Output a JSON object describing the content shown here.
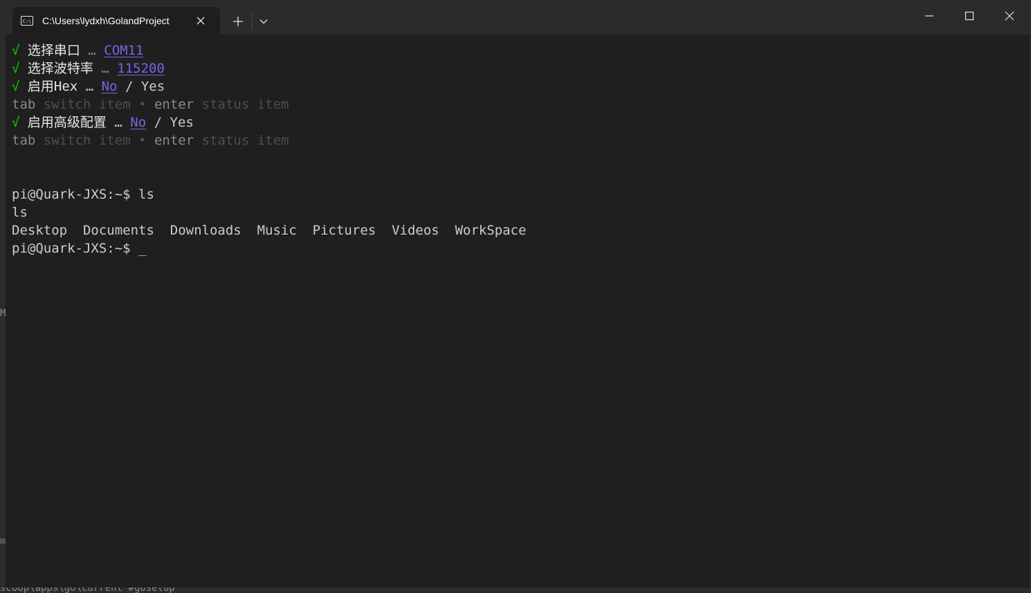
{
  "tab": {
    "icon": "terminal-prompt-icon",
    "title": "C:\\Users\\lydxh\\GolandProject"
  },
  "window_controls": {
    "minimize_icon": "minimize-icon",
    "maximize_icon": "maximize-icon",
    "close_icon": "close-icon"
  },
  "terminal": {
    "prompts": [
      {
        "check": "√",
        "question": "选择串口",
        "sep": "…",
        "answer": "COM11"
      },
      {
        "check": "√",
        "question": "选择波特率",
        "sep": "…",
        "answer": "115200"
      },
      {
        "check": "√",
        "question": "启用Hex",
        "sep": "…",
        "selected": "No",
        "slash": "/",
        "other": "Yes"
      },
      {
        "check": "√",
        "question": "启用高级配置",
        "sep": "…",
        "selected": "No",
        "slash": "/",
        "other": "Yes"
      }
    ],
    "hint": {
      "key1": "tab",
      "desc1": "switch item",
      "bullet": "•",
      "key2": "enter",
      "desc2": "status item"
    },
    "shell": {
      "prompt1": "pi@Quark-JXS:~$ ls",
      "echo": "ls",
      "listing": "Desktop  Documents  Downloads  Music  Pictures  Videos  WorkSpace",
      "prompt2": "pi@Quark-JXS:~$ ",
      "cursor": "_"
    }
  },
  "background": {
    "left_edge_text": "M",
    "bottom_text": "scoop\\apps\\go\\current #gosetup"
  },
  "colors": {
    "check": "#16c60c",
    "accent": "#7a63e8",
    "terminal_bg": "#1f1f1f",
    "titlebar_bg": "#2b2b2b"
  }
}
